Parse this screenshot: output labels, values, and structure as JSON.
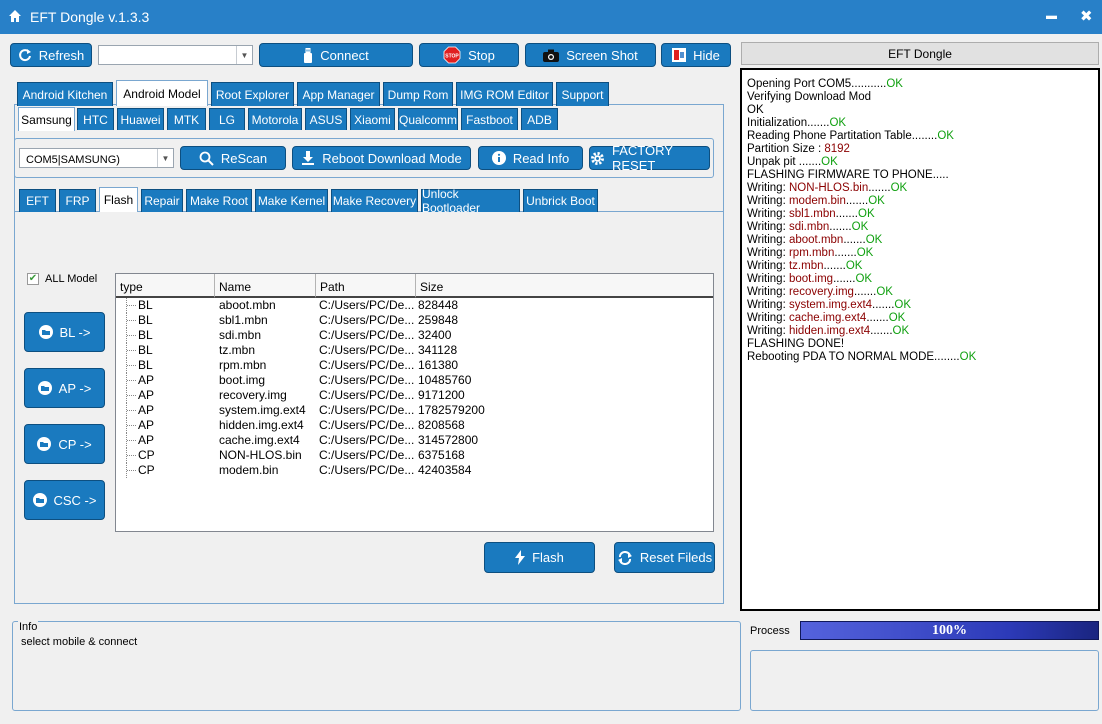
{
  "window": {
    "title": "EFT Dongle  v.1.3.3",
    "minimize": "▬",
    "close": "✖"
  },
  "toolbar": {
    "refresh": "Refresh",
    "port_value": "",
    "connect": "Connect",
    "stop": "Stop",
    "stop_badge": "STOP",
    "screenshot": "Screen Shot",
    "hide": "Hide"
  },
  "right_header": "EFT Dongle",
  "main_tabs": [
    "Android Kitchen",
    "Android Model",
    "Root Explorer",
    "App Manager",
    "Dump Rom",
    "IMG ROM Editor",
    "Support"
  ],
  "brand_tabs": [
    "Samsung",
    "HTC",
    "Huawei",
    "MTK",
    "LG",
    "Motorola",
    "ASUS",
    "Xiaomi",
    "Qualcomm",
    "Fastboot",
    "ADB"
  ],
  "device": {
    "port": "COM5|SAMSUNG)",
    "rescan": "ReScan",
    "reboot": "Reboot  Download Mode",
    "read_info": "Read Info",
    "factory_reset": "FACTORY RESET"
  },
  "func_tabs": [
    "EFT",
    "FRP",
    "Flash",
    "Repair",
    "Make Root",
    "Make Kernel",
    "Make Recovery",
    "Unlock Bootloader",
    "Unbrick Boot"
  ],
  "all_model": "ALL Model",
  "side_buttons": {
    "bl": "BL ->",
    "ap": "AP ->",
    "cp": "CP ->",
    "csc": "CSC ->"
  },
  "table": {
    "columns": [
      "type",
      "Name",
      "Path",
      "Size"
    ],
    "rows": [
      [
        "BL",
        "aboot.mbn",
        "C:/Users/PC/De...",
        "828448"
      ],
      [
        "BL",
        "sbl1.mbn",
        "C:/Users/PC/De...",
        "259848"
      ],
      [
        "BL",
        "sdi.mbn",
        "C:/Users/PC/De...",
        "32400"
      ],
      [
        "BL",
        "tz.mbn",
        "C:/Users/PC/De...",
        "341128"
      ],
      [
        "BL",
        "rpm.mbn",
        "C:/Users/PC/De...",
        "161380"
      ],
      [
        "AP",
        "boot.img",
        "C:/Users/PC/De...",
        "10485760"
      ],
      [
        "AP",
        "recovery.img",
        "C:/Users/PC/De...",
        "9171200"
      ],
      [
        "AP",
        "system.img.ext4",
        "C:/Users/PC/De...",
        "1782579200"
      ],
      [
        "AP",
        "hidden.img.ext4",
        "C:/Users/PC/De...",
        "8208568"
      ],
      [
        "AP",
        "cache.img.ext4",
        "C:/Users/PC/De...",
        "314572800"
      ],
      [
        "CP",
        "NON-HLOS.bin",
        "C:/Users/PC/De...",
        "6375168"
      ],
      [
        "CP",
        "modem.bin",
        "C:/Users/PC/De...",
        "42403584"
      ]
    ]
  },
  "actions": {
    "flash": "Flash",
    "reset": "Reset Fileds"
  },
  "info": {
    "title": "Info",
    "text": "select mobile & connect"
  },
  "process": {
    "label": "Process",
    "percent": "100%",
    "value": 1.0
  },
  "log": [
    [
      [
        "Opening Port COM5...........",
        ""
      ],
      [
        "OK",
        "ok"
      ]
    ],
    [
      [
        "Verifying Download Mod",
        ""
      ]
    ],
    [
      [
        "OK",
        ""
      ]
    ],
    [
      [
        "Initialization.......",
        ""
      ],
      [
        "OK",
        "ok"
      ]
    ],
    [
      [
        "Reading Phone Partitation Table........",
        ""
      ],
      [
        "OK",
        "ok"
      ]
    ],
    [
      [
        "Partition Size : ",
        ""
      ],
      [
        "8192",
        "red"
      ]
    ],
    [
      [
        "Unpak pit .......",
        ""
      ],
      [
        "OK",
        "ok"
      ]
    ],
    [
      [
        "FLASHING FIRMWARE TO PHONE.....",
        ""
      ]
    ],
    [
      [
        "Writing: ",
        ""
      ],
      [
        "NON-HLOS.bin",
        "red"
      ],
      [
        ".......",
        ""
      ],
      [
        "OK",
        "ok"
      ]
    ],
    [
      [
        "Writing: ",
        ""
      ],
      [
        "modem.bin",
        "red"
      ],
      [
        ".......",
        ""
      ],
      [
        "OK",
        "ok"
      ]
    ],
    [
      [
        "Writing: ",
        ""
      ],
      [
        "sbl1.mbn",
        "red"
      ],
      [
        ".......",
        ""
      ],
      [
        "OK",
        "ok"
      ]
    ],
    [
      [
        "Writing: ",
        ""
      ],
      [
        "sdi.mbn",
        "red"
      ],
      [
        ".......",
        ""
      ],
      [
        "OK",
        "ok"
      ]
    ],
    [
      [
        "Writing: ",
        ""
      ],
      [
        "aboot.mbn",
        "red"
      ],
      [
        ".......",
        ""
      ],
      [
        "OK",
        "ok"
      ]
    ],
    [
      [
        "Writing: ",
        ""
      ],
      [
        "rpm.mbn",
        "red"
      ],
      [
        ".......",
        ""
      ],
      [
        "OK",
        "ok"
      ]
    ],
    [
      [
        "Writing: ",
        ""
      ],
      [
        "tz.mbn",
        "red"
      ],
      [
        ".......",
        ""
      ],
      [
        "OK",
        "ok"
      ]
    ],
    [
      [
        "Writing: ",
        ""
      ],
      [
        "boot.img",
        "red"
      ],
      [
        ".......",
        ""
      ],
      [
        "OK",
        "ok"
      ]
    ],
    [
      [
        "Writing: ",
        ""
      ],
      [
        "recovery.img",
        "red"
      ],
      [
        ".......",
        ""
      ],
      [
        "OK",
        "ok"
      ]
    ],
    [
      [
        "Writing: ",
        ""
      ],
      [
        "system.img.ext4",
        "red"
      ],
      [
        ".......",
        ""
      ],
      [
        "OK",
        "ok"
      ]
    ],
    [
      [
        "Writing: ",
        ""
      ],
      [
        "cache.img.ext4",
        "red"
      ],
      [
        ".......",
        ""
      ],
      [
        "OK",
        "ok"
      ]
    ],
    [
      [
        "Writing: ",
        ""
      ],
      [
        "hidden.img.ext4",
        "red"
      ],
      [
        ".......",
        ""
      ],
      [
        "OK",
        "ok"
      ]
    ],
    [
      [
        "FLASHING DONE!",
        ""
      ]
    ],
    [
      [
        "Rebooting PDA TO NORMAL MODE........",
        ""
      ],
      [
        "OK",
        "ok"
      ]
    ]
  ],
  "colors": {
    "titlebar": "#2880c8",
    "button": "#1a7abf",
    "ok": "#10a010",
    "value_red": "#8b0000",
    "progress": "#3a4bc8"
  }
}
